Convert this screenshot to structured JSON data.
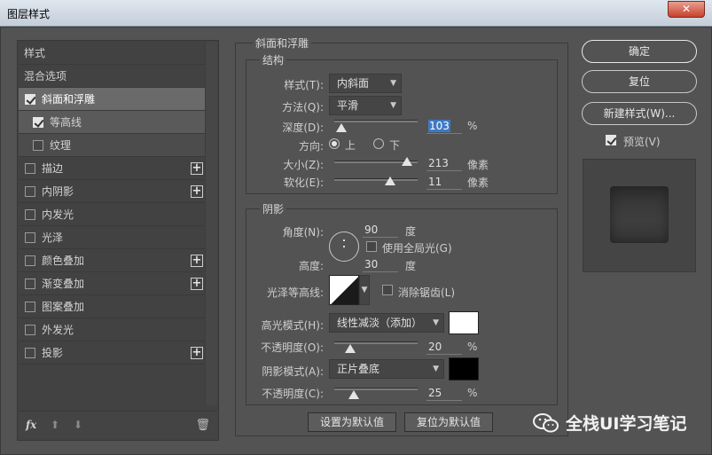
{
  "window": {
    "title": "图层样式",
    "close_glyph": "✕"
  },
  "left": {
    "header": "样式",
    "blend_options": "混合选项",
    "items": [
      {
        "label": "斜面和浮雕",
        "checked": true,
        "plus": false
      },
      {
        "label": "等高线",
        "checked": true,
        "plus": false
      },
      {
        "label": "纹理",
        "checked": false,
        "plus": false
      },
      {
        "label": "描边",
        "checked": false,
        "plus": true
      },
      {
        "label": "内阴影",
        "checked": false,
        "plus": true
      },
      {
        "label": "内发光",
        "checked": false,
        "plus": false
      },
      {
        "label": "光泽",
        "checked": false,
        "plus": false
      },
      {
        "label": "颜色叠加",
        "checked": false,
        "plus": true
      },
      {
        "label": "渐变叠加",
        "checked": false,
        "plus": true
      },
      {
        "label": "图案叠加",
        "checked": false,
        "plus": false
      },
      {
        "label": "外发光",
        "checked": false,
        "plus": false
      },
      {
        "label": "投影",
        "checked": false,
        "plus": true
      }
    ],
    "plus_glyph": "+",
    "footer": {
      "fx": "fx",
      "up": "⬆",
      "down": "⬇",
      "trash": "🗑"
    }
  },
  "bevel": {
    "group_title": "斜面和浮雕",
    "structure_title": "结构",
    "style_label": "样式(T):",
    "style_value": "内斜面",
    "technique_label": "方法(Q):",
    "technique_value": "平滑",
    "depth_label": "深度(D):",
    "depth_value": "103",
    "depth_unit": "%",
    "depth_percent": 103,
    "direction_label": "方向:",
    "direction_up": "上",
    "direction_down": "下",
    "size_label": "大小(Z):",
    "size_value": "213",
    "size_unit": "像素",
    "soften_label": "软化(E):",
    "soften_value": "11",
    "soften_unit": "像素"
  },
  "shading": {
    "title": "阴影",
    "angle_label": "角度(N):",
    "angle_value": "90",
    "angle_unit": "度",
    "global_light_label": "使用全局光(G)",
    "altitude_label": "高度:",
    "altitude_value": "30",
    "altitude_unit": "度",
    "gloss_label": "光泽等高线:",
    "anti_alias_label": "消除锯齿(L)",
    "highlight_label": "高光模式(H):",
    "highlight_value": "线性减淡（添加）",
    "highlight_color": "#ffffff",
    "highlight_opacity_label": "不透明度(O):",
    "highlight_opacity": "20",
    "highlight_opacity_unit": "%",
    "shadow_label": "阴影模式(A):",
    "shadow_value": "正片叠底",
    "shadow_color": "#000000",
    "shadow_opacity_label": "不透明度(C):",
    "shadow_opacity": "25",
    "shadow_opacity_unit": "%"
  },
  "buttons": {
    "make_default": "设置为默认值",
    "reset_default": "复位为默认值"
  },
  "right": {
    "ok": "确定",
    "reset": "复位",
    "new_style": "新建样式(W)...",
    "preview_label": "预览(V)"
  },
  "watermark": "全栈UI学习笔记"
}
